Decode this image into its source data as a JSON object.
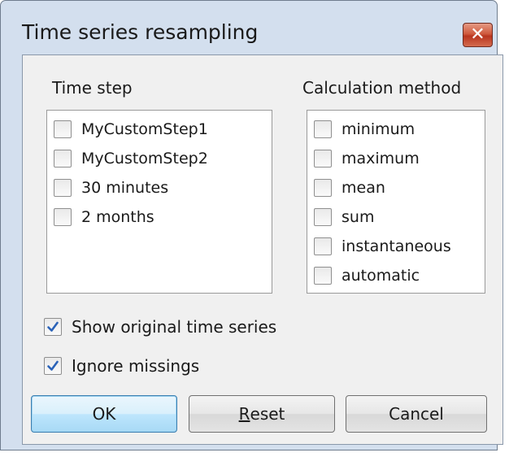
{
  "window": {
    "title": "Time series resampling",
    "close_glyph": "✕"
  },
  "time_step": {
    "label": "Time step",
    "items": [
      {
        "label": "MyCustomStep1",
        "checked": false
      },
      {
        "label": "MyCustomStep2",
        "checked": false
      },
      {
        "label": "30 minutes",
        "checked": false
      },
      {
        "label": "2 months",
        "checked": false
      }
    ]
  },
  "calculation_method": {
    "label": "Calculation method",
    "items": [
      {
        "label": "minimum",
        "checked": false
      },
      {
        "label": "maximum",
        "checked": false
      },
      {
        "label": "mean",
        "checked": false
      },
      {
        "label": "sum",
        "checked": false
      },
      {
        "label": "instantaneous",
        "checked": false
      },
      {
        "label": "automatic",
        "checked": false
      }
    ]
  },
  "options": {
    "show_original": {
      "label": "Show original time series",
      "checked": true
    },
    "ignore_missings": {
      "label": "Ignore missings",
      "checked": true
    }
  },
  "buttons": {
    "ok": "OK",
    "reset_accel": "R",
    "reset_rest": "eset",
    "cancel": "Cancel"
  },
  "colors": {
    "check_mark": "#2a62b8",
    "default_button_border": "#3c7fb1",
    "close_button": "#c94a2f"
  }
}
